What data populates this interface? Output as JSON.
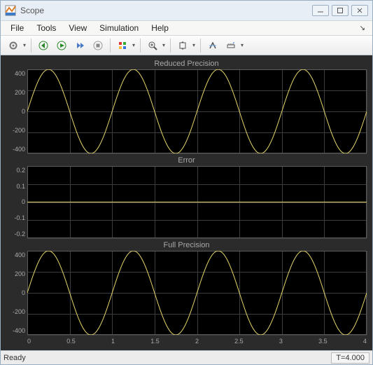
{
  "window": {
    "title": "Scope"
  },
  "menu": {
    "file": "File",
    "tools": "Tools",
    "view": "View",
    "simulation": "Simulation",
    "help": "Help"
  },
  "status": {
    "ready": "Ready",
    "time": "T=4.000"
  },
  "subplots": {
    "reduced": {
      "title": "Reduced Precision",
      "yticks": [
        "400",
        "200",
        "0",
        "-200",
        "-400"
      ]
    },
    "error": {
      "title": "Error",
      "yticks": [
        "0.2",
        "0.1",
        "0",
        "-0.1",
        "-0.2"
      ]
    },
    "full": {
      "title": "Full Precision",
      "yticks": [
        "400",
        "200",
        "0",
        "-200",
        "-400"
      ]
    }
  },
  "xaxis": {
    "ticks": [
      "0",
      "0.5",
      "1",
      "1.5",
      "2",
      "2.5",
      "3",
      "3.5",
      "4"
    ]
  },
  "chart_data": [
    {
      "type": "line",
      "title": "Reduced Precision",
      "xlabel": "",
      "ylabel": "",
      "xlim": [
        0,
        4
      ],
      "ylim": [
        -400,
        400
      ],
      "series": [
        {
          "name": "reduced",
          "formula": "400*sin(2*pi*x)",
          "x": [
            0,
            0.25,
            0.5,
            0.75,
            1,
            1.25,
            1.5,
            1.75,
            2,
            2.25,
            2.5,
            2.75,
            3,
            3.25,
            3.5,
            3.75,
            4
          ],
          "y": [
            0,
            400,
            0,
            -400,
            0,
            400,
            0,
            -400,
            0,
            400,
            0,
            -400,
            0,
            400,
            0,
            -400,
            0
          ]
        }
      ]
    },
    {
      "type": "line",
      "title": "Error",
      "xlabel": "",
      "ylabel": "",
      "xlim": [
        0,
        4
      ],
      "ylim": [
        -0.2,
        0.2
      ],
      "series": [
        {
          "name": "error",
          "x": [
            0,
            4
          ],
          "y": [
            0,
            0
          ]
        }
      ]
    },
    {
      "type": "line",
      "title": "Full Precision",
      "xlabel": "",
      "ylabel": "",
      "xlim": [
        0,
        4
      ],
      "ylim": [
        -400,
        400
      ],
      "series": [
        {
          "name": "full",
          "formula": "400*sin(2*pi*x)",
          "x": [
            0,
            0.25,
            0.5,
            0.75,
            1,
            1.25,
            1.5,
            1.75,
            2,
            2.25,
            2.5,
            2.75,
            3,
            3.25,
            3.5,
            3.75,
            4
          ],
          "y": [
            0,
            400,
            0,
            -400,
            0,
            400,
            0,
            -400,
            0,
            400,
            0,
            -400,
            0,
            400,
            0,
            -400,
            0
          ]
        }
      ]
    }
  ]
}
